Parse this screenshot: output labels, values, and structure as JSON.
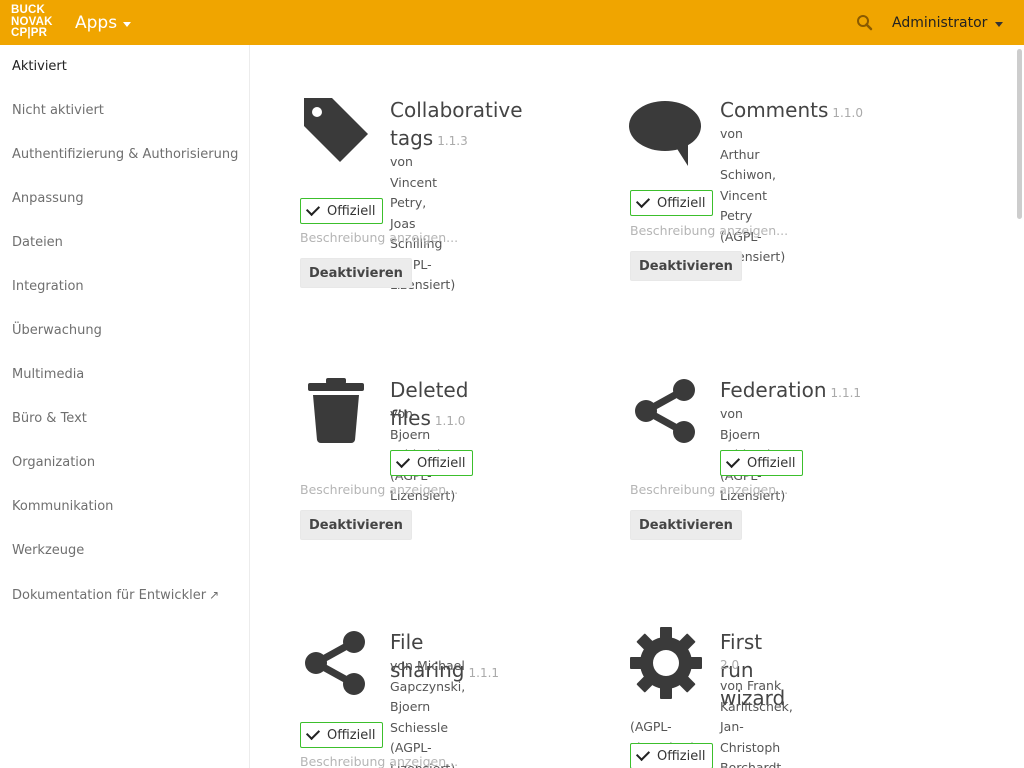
{
  "header": {
    "logo_lines": [
      "BUCK",
      "NOVAK",
      "CP|PR"
    ],
    "apps_label": "Apps",
    "user_label": "Administrator",
    "search_icon": "search-icon",
    "bg_color": "#f0a500"
  },
  "sidebar": {
    "items": [
      {
        "label": "Aktiviert",
        "active": true
      },
      {
        "label": "Nicht aktiviert"
      },
      {
        "label": "Authentifizierung & Authorisierung"
      },
      {
        "label": "Anpassung"
      },
      {
        "label": "Dateien"
      },
      {
        "label": "Integration"
      },
      {
        "label": "Überwachung"
      },
      {
        "label": "Multimedia"
      },
      {
        "label": "Büro & Text"
      },
      {
        "label": "Organization"
      },
      {
        "label": "Kommunikation"
      },
      {
        "label": "Werkzeuge"
      },
      {
        "label": "Dokumentation für Entwickler",
        "external_icon": "↗"
      }
    ]
  },
  "apps": [
    {
      "name": "Collaborative tags",
      "name_line1": "Collaborative",
      "name_line2": "tags",
      "version": "1.1.3",
      "author_lines": [
        "von Vincent Petry, Joas",
        "Schilling (AGPL-Lizensiert)"
      ],
      "badge": "Offiziell",
      "desc_link": "Beschreibung anzeigen...",
      "button": "Deaktivieren",
      "icon": "tag-icon"
    },
    {
      "name": "Comments",
      "version": "1.1.0",
      "author_lines": [
        "von Arthur Schiwon,",
        "Vincent Petry (AGPL-",
        "Lizensiert)"
      ],
      "badge": "Offiziell",
      "desc_link": "Beschreibung anzeigen...",
      "button": "Deaktivieren",
      "icon": "comment-icon"
    },
    {
      "name": "Deleted files",
      "version": "1.1.0",
      "author_lines": [
        "von Bjoern Schiessle",
        "(AGPL-Lizensiert)"
      ],
      "badge": "Offiziell",
      "desc_link": "Beschreibung anzeigen...",
      "button": "Deaktivieren",
      "icon": "trash-icon"
    },
    {
      "name": "Federation",
      "version": "1.1.1",
      "author_lines": [
        "von Bjoern Schiessle",
        "(AGPL-Lizensiert)"
      ],
      "badge": "Offiziell",
      "desc_link": "Beschreibung anzeigen...",
      "button": "Deaktivieren",
      "icon": "share-icon"
    },
    {
      "name": "File sharing",
      "version": "1.1.1",
      "author_lines": [
        "von Michael Gapczynski,",
        "Bjoern Schiessle (AGPL-",
        "Lizensiert)"
      ],
      "badge": "Offiziell",
      "desc_link": "Beschreibung anzeigen...",
      "icon": "share-icon"
    },
    {
      "name": "First run wizard",
      "version": "2.0",
      "author_lines": [
        "von Frank Karlitschek,",
        "Jan-Christoph Borchardt",
        "(AGPL-Lizensiert)"
      ],
      "badge": "Offiziell",
      "icon": "gear-icon"
    }
  ]
}
